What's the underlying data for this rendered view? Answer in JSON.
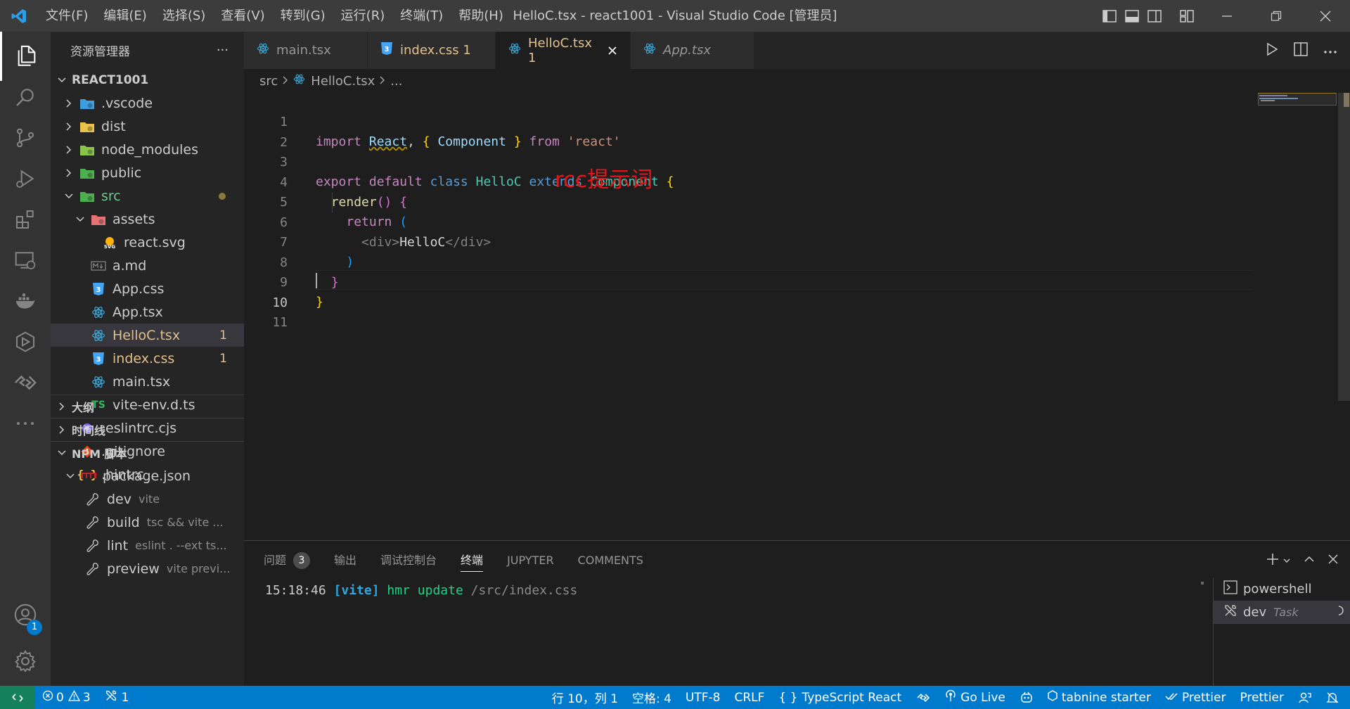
{
  "titlebar": {
    "menus": [
      "文件(F)",
      "编辑(E)",
      "选择(S)",
      "查看(V)",
      "转到(G)",
      "运行(R)",
      "终端(T)",
      "帮助(H)"
    ],
    "title": "HelloC.tsx - react1001 - Visual Studio Code [管理员]"
  },
  "activity": {
    "accounts_badge": "1"
  },
  "sidebar": {
    "header": "资源管理器",
    "more": "···",
    "root": "REACT1001",
    "tree": [
      {
        "label": ".vscode",
        "icon": "vscode-folder-icon",
        "iconColor": "#3e9fe0",
        "indent": 0,
        "folder": true,
        "open": false
      },
      {
        "label": "dist",
        "icon": "folder-icon",
        "iconColor": "#e8c24a",
        "indent": 0,
        "folder": true,
        "open": false
      },
      {
        "label": "node_modules",
        "icon": "node-folder-icon",
        "iconColor": "#8bc34a",
        "indent": 0,
        "folder": true,
        "open": false
      },
      {
        "label": "public",
        "icon": "public-folder-icon",
        "iconColor": "#4caf50",
        "indent": 0,
        "folder": true,
        "open": false
      },
      {
        "label": "src",
        "icon": "src-folder-icon",
        "iconColor": "#4caf50",
        "indent": 0,
        "folder": true,
        "open": true,
        "dot": true,
        "mod": true
      },
      {
        "label": "assets",
        "icon": "assets-folder-icon",
        "iconColor": "#e57373",
        "indent": 1,
        "folder": true,
        "open": true
      },
      {
        "label": "react.svg",
        "icon": "svg-file-icon",
        "iconColor": "#ffb300",
        "indent": 2,
        "folder": false
      },
      {
        "label": "a.md",
        "icon": "markdown-file-icon",
        "iconColor": "#8c8c8c",
        "indent": 1,
        "folder": false
      },
      {
        "label": "App.css",
        "icon": "css-file-icon",
        "iconColor": "#42a5f5",
        "indent": 1,
        "folder": false
      },
      {
        "label": "App.tsx",
        "icon": "react-file-icon",
        "iconColor": "#3ba7d8",
        "indent": 1,
        "folder": false
      },
      {
        "label": "HelloC.tsx",
        "icon": "react-file-icon",
        "iconColor": "#3ba7d8",
        "indent": 1,
        "folder": false,
        "selected": true,
        "count": "1",
        "mod": true
      },
      {
        "label": "index.css",
        "icon": "css-file-icon",
        "iconColor": "#42a5f5",
        "indent": 1,
        "folder": false,
        "count": "1",
        "mod": true
      },
      {
        "label": "main.tsx",
        "icon": "react-file-icon",
        "iconColor": "#3ba7d8",
        "indent": 1,
        "folder": false
      },
      {
        "label": "vite-env.d.ts",
        "icon": "ts-file-icon",
        "iconColor": "#2fb85f",
        "indent": 1,
        "folder": false
      },
      {
        "label": ".eslintrc.cjs",
        "icon": "eslint-file-icon",
        "iconColor": "#7c6cf0",
        "indent": 0,
        "folder": false
      },
      {
        "label": ".gitignore",
        "icon": "git-file-icon",
        "iconColor": "#e64a19",
        "indent": 0,
        "folder": false
      },
      {
        "label": ".hintrc",
        "icon": "json-file-icon",
        "iconColor": "#f0c94f",
        "indent": 0,
        "folder": false
      }
    ],
    "outline": "大纲",
    "timeline": "时间线",
    "npm": "NPM 脚本",
    "package": "package.json",
    "scripts": [
      {
        "name": "dev",
        "cmd": "vite"
      },
      {
        "name": "build",
        "cmd": "tsc && vite ..."
      },
      {
        "name": "lint",
        "cmd": "eslint . --ext ts..."
      },
      {
        "name": "preview",
        "cmd": "vite previ..."
      }
    ]
  },
  "tabs": [
    {
      "label": "main.tsx",
      "icon": "react-file-icon",
      "active": false
    },
    {
      "label": "index.css 1",
      "icon": "css-file-icon",
      "active": false,
      "mod": true
    },
    {
      "label": "HelloC.tsx 1",
      "icon": "react-file-icon",
      "active": true,
      "mod": true
    },
    {
      "label": "App.tsx",
      "icon": "react-file-icon",
      "active": false,
      "italic": true
    }
  ],
  "breadcrumb": {
    "folder": "src",
    "file": "HelloC.tsx",
    "more": "..."
  },
  "editor": {
    "lines": [
      "1",
      "2",
      "3",
      "4",
      "5",
      "6",
      "7",
      "8",
      "9",
      "10",
      "11"
    ],
    "current_line": "10",
    "tokens": {
      "import": "import",
      "React": "React",
      "comma": ",",
      "lb": "{",
      "Component": "Component",
      "rb": "}",
      "from": "from",
      "react": "'react'",
      "export": "export",
      "default": "default",
      "class": "class",
      "HelloC": "HelloC",
      "extends": "extends",
      "render": "render",
      "parens": "()",
      "return": "return",
      "lp": "(",
      "rp": ")",
      "div_open": "<div>",
      "div_text": "HelloC",
      "div_close": "</div>"
    },
    "annotation": "rcc提示词"
  },
  "panel": {
    "tabs": [
      "问题",
      "输出",
      "调试控制台",
      "终端",
      "JUPYTER",
      "COMMENTS"
    ],
    "problems_count": "3",
    "active_tab": "终端",
    "terminal": {
      "time": "15:18:46",
      "vite": "[vite]",
      "hmr": "hmr update",
      "path": "/src/index.css"
    },
    "terminals": [
      {
        "name": "powershell",
        "sub": ""
      },
      {
        "name": "dev",
        "sub": "Task"
      }
    ]
  },
  "statusbar": {
    "errors": "0",
    "warnings": "3",
    "ports": "1",
    "position": "行 10，列 1",
    "spaces": "空格: 4",
    "encoding": "UTF-8",
    "eol": "CRLF",
    "language": "TypeScript React",
    "golive": "Go Live",
    "tabnine": "tabnine starter",
    "prettier_check": "Prettier",
    "prettier": "Prettier"
  },
  "colors": {
    "accent": "#007acc",
    "statusbar": "#007acc",
    "remote": "#16825d",
    "annotation": "#e5141a",
    "modified": "#e2c08d"
  }
}
